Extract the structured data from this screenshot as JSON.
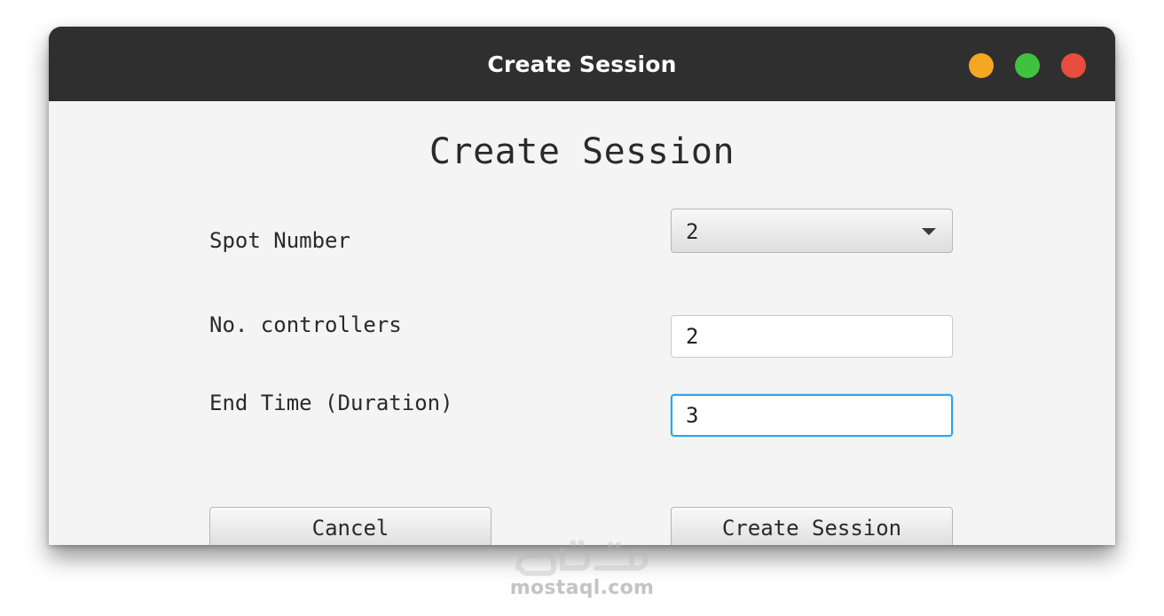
{
  "window": {
    "title": "Create Session",
    "controls": {
      "minimize_color": "#f5a623",
      "maximize_color": "#3fc23f",
      "close_color": "#e84c3d"
    }
  },
  "form": {
    "heading": "Create Session",
    "fields": [
      {
        "label": "Spot Number",
        "type": "select",
        "value": "2"
      },
      {
        "label": "No. controllers",
        "type": "text",
        "value": "2"
      },
      {
        "label": "End Time (Duration)",
        "type": "text",
        "value": "3",
        "focused": true
      }
    ],
    "buttons": {
      "cancel_label": "Cancel",
      "create_label": "Create Session"
    }
  },
  "watermark": {
    "text": "mostaql.com",
    "logo_text": "مستقل"
  },
  "colors": {
    "titlebar_bg": "#2f2f2f",
    "content_bg": "#f4f4f4",
    "focus_ring": "#2aa7e8"
  }
}
